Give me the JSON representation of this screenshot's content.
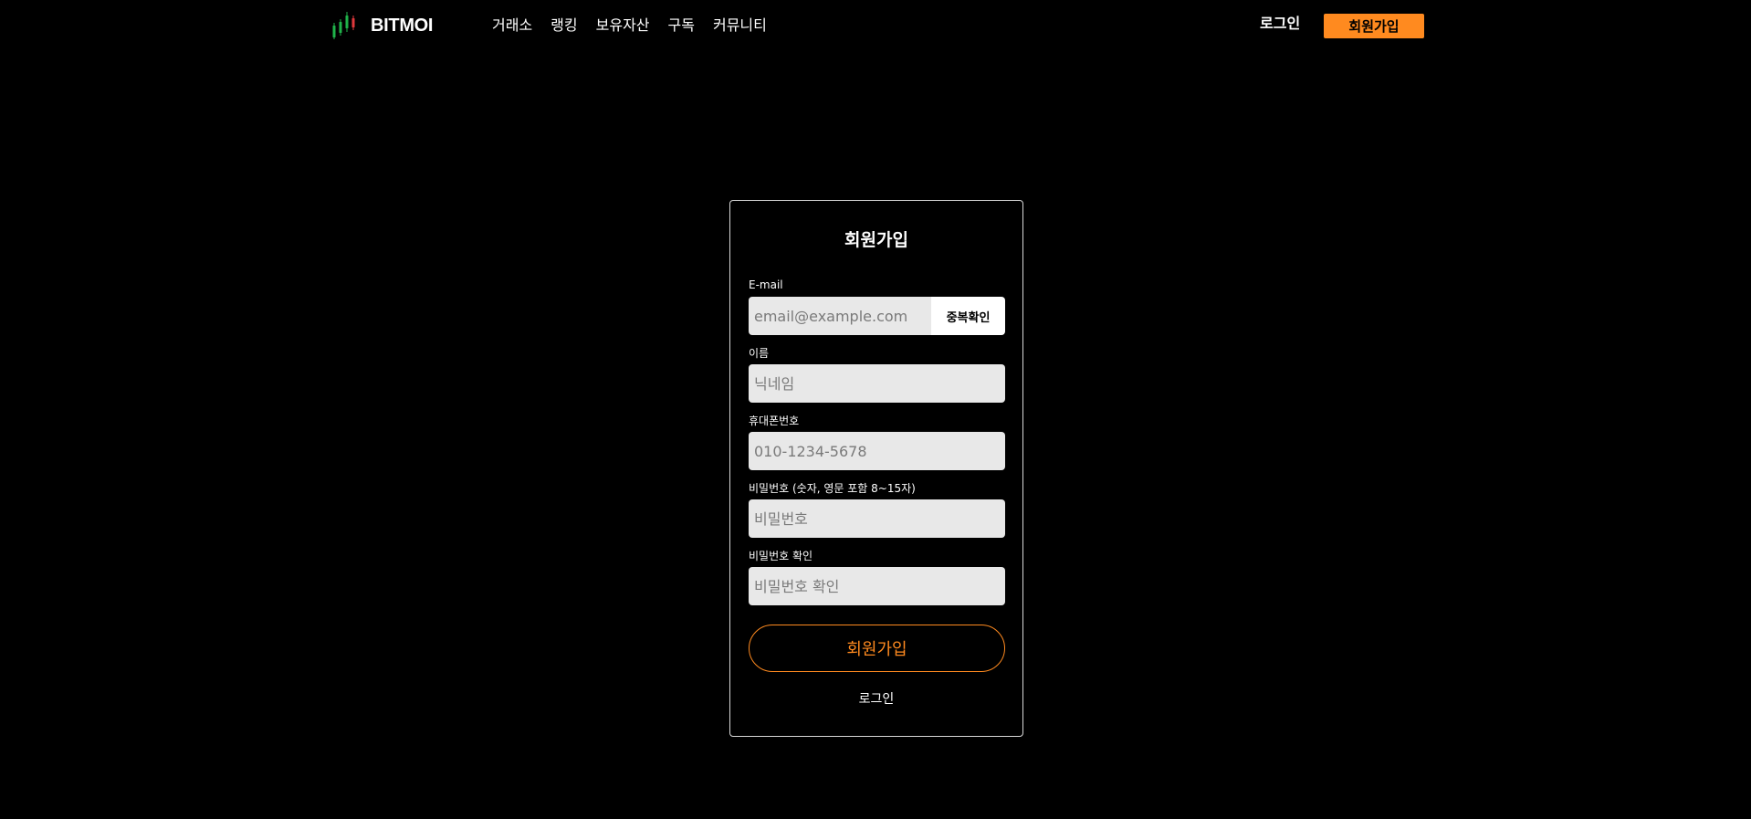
{
  "header": {
    "logo_text": "BITMOI",
    "logo_icon": "candlestick-chart-icon",
    "nav_items": [
      {
        "label": "거래소"
      },
      {
        "label": "랭킹"
      },
      {
        "label": "보유자산"
      },
      {
        "label": "구독"
      },
      {
        "label": "커뮤니티"
      }
    ],
    "login_label": "로그인",
    "signup_label": "회원가입"
  },
  "colors": {
    "background": "#000000",
    "accent": "#ff8a1f",
    "input_background": "#e8e8e8",
    "candle_green": "#1fb34a",
    "candle_red": "#e0383b"
  },
  "signup_form": {
    "title": "회원가입",
    "email": {
      "label": "E-mail",
      "placeholder": "email@example.com",
      "value": "",
      "check_button": "중복확인"
    },
    "name": {
      "label": "이름",
      "placeholder": "닉네임",
      "value": ""
    },
    "phone": {
      "label": "휴대폰번호",
      "placeholder": "010-1234-5678",
      "value": ""
    },
    "password": {
      "label": "비밀번호 (숫자, 영문 포함 8~15자)",
      "placeholder": "비밀번호",
      "value": ""
    },
    "password_confirm": {
      "label": "비밀번호 확인",
      "placeholder": "비밀번호 확인",
      "value": ""
    },
    "submit_label": "회원가입",
    "login_link": "로그인"
  }
}
